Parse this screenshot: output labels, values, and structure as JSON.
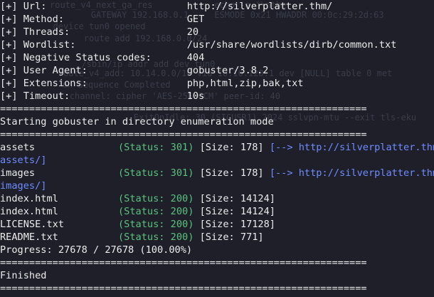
{
  "colors": {
    "background": "#1e1f29",
    "text": "#ececec",
    "status": "#59c47d",
    "redirect": "#6f8cff",
    "ghost": "#3a3c4a"
  },
  "ghost_lines": [
    "route_v4_next_ga_res            echo -e \"\\nthe",
    "        GATEWAY 192.168.0.1     ESMODE 0x21 HWADDR 00:0c:29:2d:63",
    "  device tun0 opened",
    "        route add 192.168.0.0/24",
    "  /sbin/ip addr add dev tun0",
    "   route_v4_add: 10.14.0.0/16 via 10.10.128.1 dev [NULL] table 0 met",
    "        on Sequence Completed",
    "        channel: cipher 'AES-256-GCM' peer-id: 40",
    "        ExitOnIdle: 30 (SIGUSR1) 2024 sslvpn-mtu --exit tls-eku"
  ],
  "config": [
    {
      "prefix": "[+]",
      "label": "Url:",
      "value": "http://silverplatter.thm/"
    },
    {
      "prefix": "[+]",
      "label": "Method:",
      "value": "GET"
    },
    {
      "prefix": "[+]",
      "label": "Threads:",
      "value": "20"
    },
    {
      "prefix": "[+]",
      "label": "Wordlist:",
      "value": "/usr/share/wordlists/dirb/common.txt"
    },
    {
      "prefix": "[+]",
      "label": "Negative Status codes:",
      "value": "404"
    },
    {
      "prefix": "[+]",
      "label": "User Agent:",
      "value": "gobuster/3.8.2"
    },
    {
      "prefix": "[+]",
      "label": "Extensions:",
      "value": "php,html,zip,bak,txt"
    },
    {
      "prefix": "[+]",
      "label": "Timeout:",
      "value": "10s"
    }
  ],
  "separator": "===============================================================",
  "mode_message": "Starting gobuster in directory enumeration mode",
  "results": [
    {
      "path": "assets",
      "status": "(Status: 301)",
      "size": "[Size: 178]",
      "redirect": "[--> http://silverplatter.thm/",
      "redirect_cont": "assets/]"
    },
    {
      "path": "images",
      "status": "(Status: 301)",
      "size": "[Size: 178]",
      "redirect": "[--> http://silverplatter.thm/",
      "redirect_cont": "images/]"
    },
    {
      "path": "index.html",
      "status": "(Status: 200)",
      "size": "[Size: 14124]"
    },
    {
      "path": "index.html",
      "status": "(Status: 200)",
      "size": "[Size: 14124]"
    },
    {
      "path": "LICENSE.txt",
      "status": "(Status: 200)",
      "size": "[Size: 17128]"
    },
    {
      "path": "README.txt",
      "status": "(Status: 200)",
      "size": "[Size: 771]"
    }
  ],
  "progress": "Progress: 27678 / 27678 (100.00%)",
  "finished": "Finished"
}
